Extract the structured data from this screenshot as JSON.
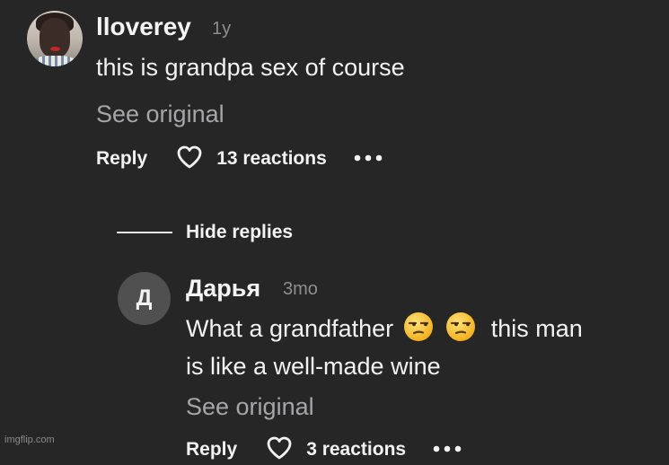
{
  "comment": {
    "username": "lloverey",
    "timestamp": "1y",
    "text": "this is grandpa sex of course",
    "see_original": "See original",
    "reply_label": "Reply",
    "reactions_label": "13 reactions",
    "more_icon": "more-horizontal-icon",
    "heart_icon": "heart-outline-icon"
  },
  "replies_toggle": {
    "label": "Hide replies"
  },
  "reply": {
    "avatar_letter": "Д",
    "username": "Дарья",
    "timestamp": "3mo",
    "text_part1": "What a grandfather",
    "emoji": "unamused-face",
    "text_part2": "this man",
    "text_line2": "is like a well-made wine",
    "see_original": "See original",
    "reply_label": "Reply",
    "reactions_label": "3 reactions"
  },
  "watermark": "imgflip.com",
  "colors": {
    "background": "#262627",
    "primary_text": "#f2f2f2",
    "secondary_text": "#8e8e90",
    "see_original": "#a6a6a8",
    "letter_avatar_bg": "#505051"
  }
}
